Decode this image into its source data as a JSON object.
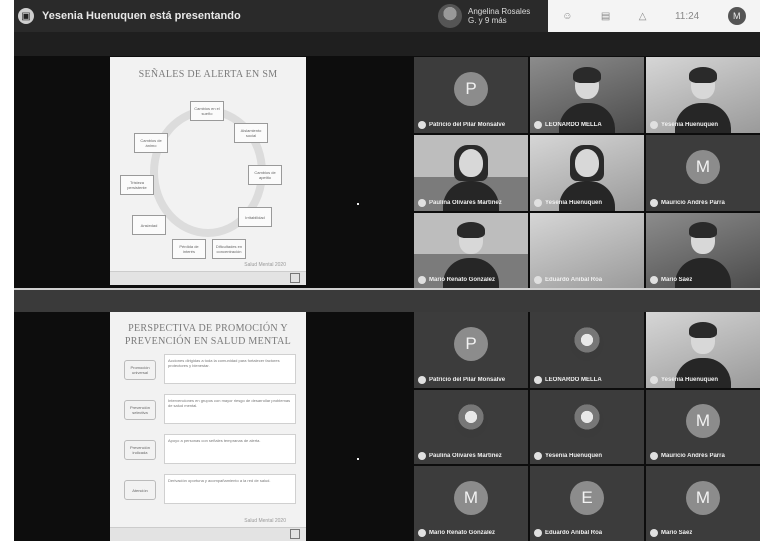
{
  "top_bar": {
    "presenting_text": "Yesenia Huenuquen está presentando",
    "mini_tile_name": "Angelina Rosales G. y 9 más",
    "clock": "11:24",
    "user_initial": "M"
  },
  "screen_a": {
    "slide_title": "SEÑALES DE ALERTA EN SM",
    "cycle_items": [
      "Cambios en el sueño",
      "Aislamiento social",
      "Cambios de apetito",
      "Irritabilidad",
      "Dificultades en concentración",
      "Pérdida de interés",
      "Ansiedad",
      "Tristeza persistente",
      "Cambios de ánimo",
      "Conductas de riesgo"
    ],
    "slide_footer": "Salud Mental 2020",
    "participants": [
      {
        "name": "Patricio del Pilar Monsalve",
        "initial": "P",
        "style": "letter"
      },
      {
        "name": "LEONARDO MELLA",
        "style": "video-dark"
      },
      {
        "name": "Yesenia Huenuquen",
        "style": "video-light"
      },
      {
        "name": "Paulina Olivares Martínez",
        "style": "video-room"
      },
      {
        "name": "Yesenia Huenuquen",
        "style": "video-light"
      },
      {
        "name": "Mauricio Andrés Parra",
        "initial": "M",
        "style": "letter"
      },
      {
        "name": "Mario Renato Gonzalez",
        "style": "video-room"
      },
      {
        "name": "Eduardo Aníbal Roa",
        "style": "video-light"
      },
      {
        "name": "Mario Sáez",
        "style": "video-dark"
      }
    ]
  },
  "screen_b": {
    "slide_title_line1": "PERSPECTIVA DE PROMOCIÓN Y",
    "slide_title_line2": "PREVENCIÓN EN SALUD MENTAL",
    "rows": [
      {
        "label": "Promoción universal",
        "text": "Acciones dirigidas a toda la comunidad para fortalecer factores protectores y bienestar."
      },
      {
        "label": "Prevención selectiva",
        "text": "Intervenciones en grupos con mayor riesgo de desarrollar problemas de salud mental."
      },
      {
        "label": "Prevención indicada",
        "text": "Apoyo a personas con señales tempranas de alerta."
      },
      {
        "label": "Atención",
        "text": "Derivación oportuna y acompañamiento a la red de salud."
      }
    ],
    "slide_footer": "Salud Mental 2020",
    "participants": [
      {
        "name": "Patricio del Pilar Monsalve",
        "initial": "P",
        "style": "letter"
      },
      {
        "name": "LEONARDO MELLA",
        "style": "photo"
      },
      {
        "name": "Yesenia Huenuquen",
        "style": "video-light"
      },
      {
        "name": "Paulina Olivares Martínez",
        "style": "photo"
      },
      {
        "name": "Yesenia Huenuquen",
        "style": "photo"
      },
      {
        "name": "Mauricio Andrés Parra",
        "initial": "M",
        "style": "letter"
      },
      {
        "name": "Mario Renato Gonzalez",
        "initial": "M",
        "style": "letter"
      },
      {
        "name": "Eduardo Aníbal Roa",
        "initial": "E",
        "style": "letter"
      },
      {
        "name": "Mario Sáez",
        "initial": "M",
        "style": "letter"
      }
    ]
  }
}
